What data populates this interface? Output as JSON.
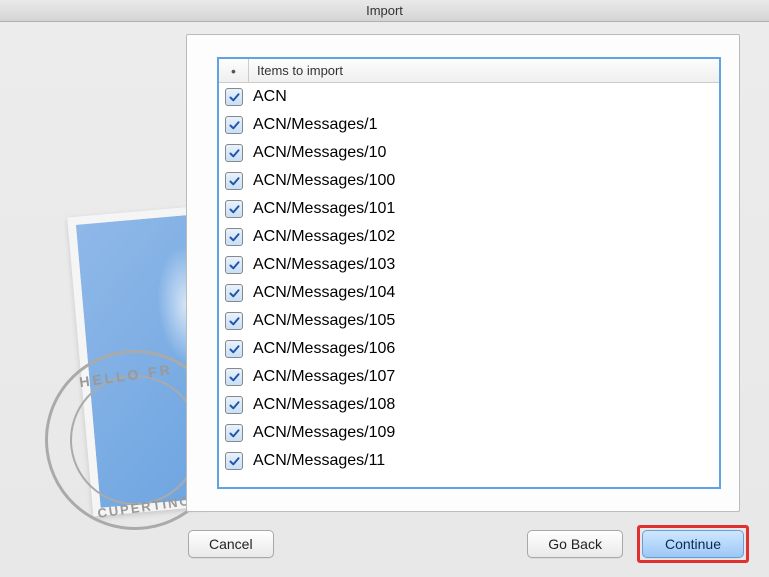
{
  "window": {
    "title": "Import"
  },
  "list": {
    "header_bullet": "•",
    "header_label": "Items to import",
    "items": [
      {
        "label": "ACN",
        "checked": true
      },
      {
        "label": "ACN/Messages/1",
        "checked": true
      },
      {
        "label": "ACN/Messages/10",
        "checked": true
      },
      {
        "label": "ACN/Messages/100",
        "checked": true
      },
      {
        "label": "ACN/Messages/101",
        "checked": true
      },
      {
        "label": "ACN/Messages/102",
        "checked": true
      },
      {
        "label": "ACN/Messages/103",
        "checked": true
      },
      {
        "label": "ACN/Messages/104",
        "checked": true
      },
      {
        "label": "ACN/Messages/105",
        "checked": true
      },
      {
        "label": "ACN/Messages/106",
        "checked": true
      },
      {
        "label": "ACN/Messages/107",
        "checked": true
      },
      {
        "label": "ACN/Messages/108",
        "checked": true
      },
      {
        "label": "ACN/Messages/109",
        "checked": true
      },
      {
        "label": "ACN/Messages/11",
        "checked": true
      }
    ]
  },
  "postmark": {
    "top_text": "HELLO FR",
    "bottom_text": "CUPERTINO"
  },
  "buttons": {
    "cancel": "Cancel",
    "goback": "Go Back",
    "continue": "Continue"
  },
  "icons": {
    "checkmark_color": "#2255aa",
    "apple_glyph": ""
  }
}
